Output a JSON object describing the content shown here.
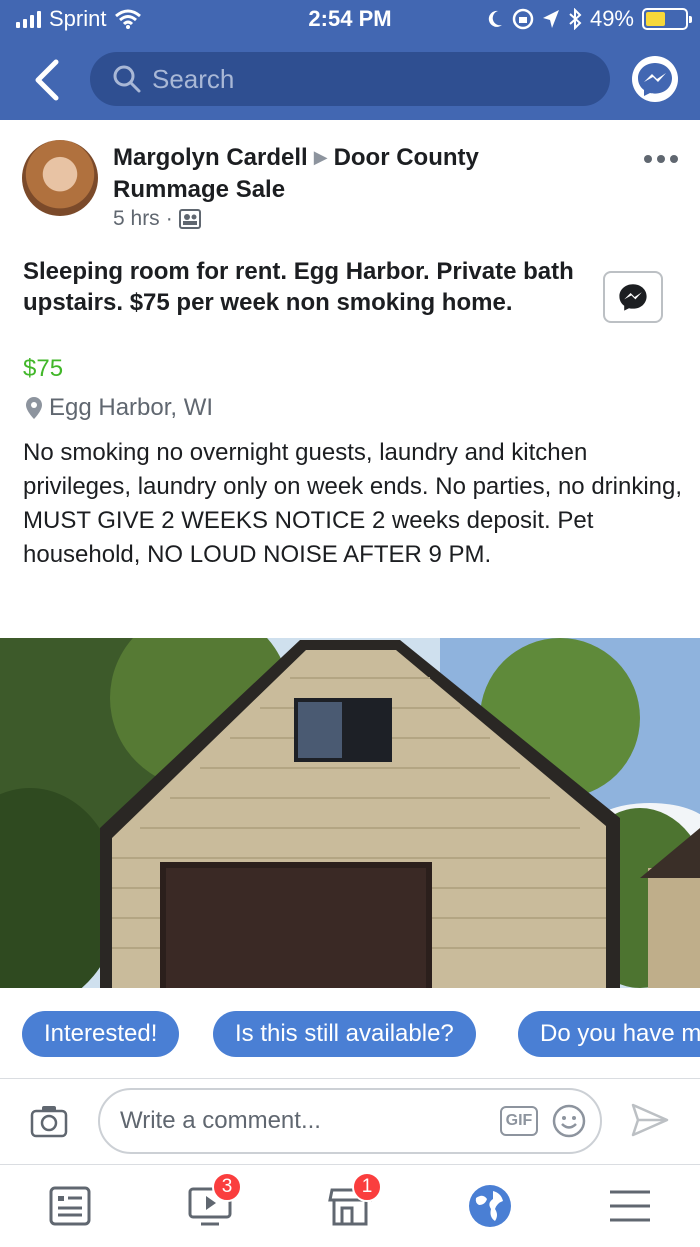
{
  "status_bar": {
    "carrier": "Sprint",
    "time": "2:54 PM",
    "battery": "49%",
    "battery_level": 0.49
  },
  "nav": {
    "back_icon": "chevron-left-icon",
    "search_placeholder": "Search",
    "messenger_icon": "messenger-icon"
  },
  "post": {
    "author": "Margolyn Cardell",
    "group": "Door County Rummage Sale",
    "time_ago": "5 hrs",
    "separator": "·",
    "title": "Sleeping room for rent. Egg Harbor. Private bath upstairs. $75 per week non smoking home.",
    "price": "$75",
    "location": "Egg Harbor, WI",
    "description": "No smoking no overnight guests, laundry and kitchen privileges, laundry only on week ends. No parties, no drinking, MUST GIVE 2 WEEKS NOTICE 2 weeks deposit. Pet household, NO LOUD NOISE AFTER 9 PM."
  },
  "quick_replies": [
    "Interested!",
    "Is this still available?",
    "Do you have more"
  ],
  "composer": {
    "placeholder": "Write a comment...",
    "gif_label": "GIF"
  },
  "tabbar": {
    "video_badge": "3",
    "marketplace_badge": "1"
  },
  "colors": {
    "brand_blue": "#4267b2",
    "chip_blue": "#4a7fd4",
    "price_green": "#42b72a",
    "badge_red": "#fa3e3e"
  }
}
